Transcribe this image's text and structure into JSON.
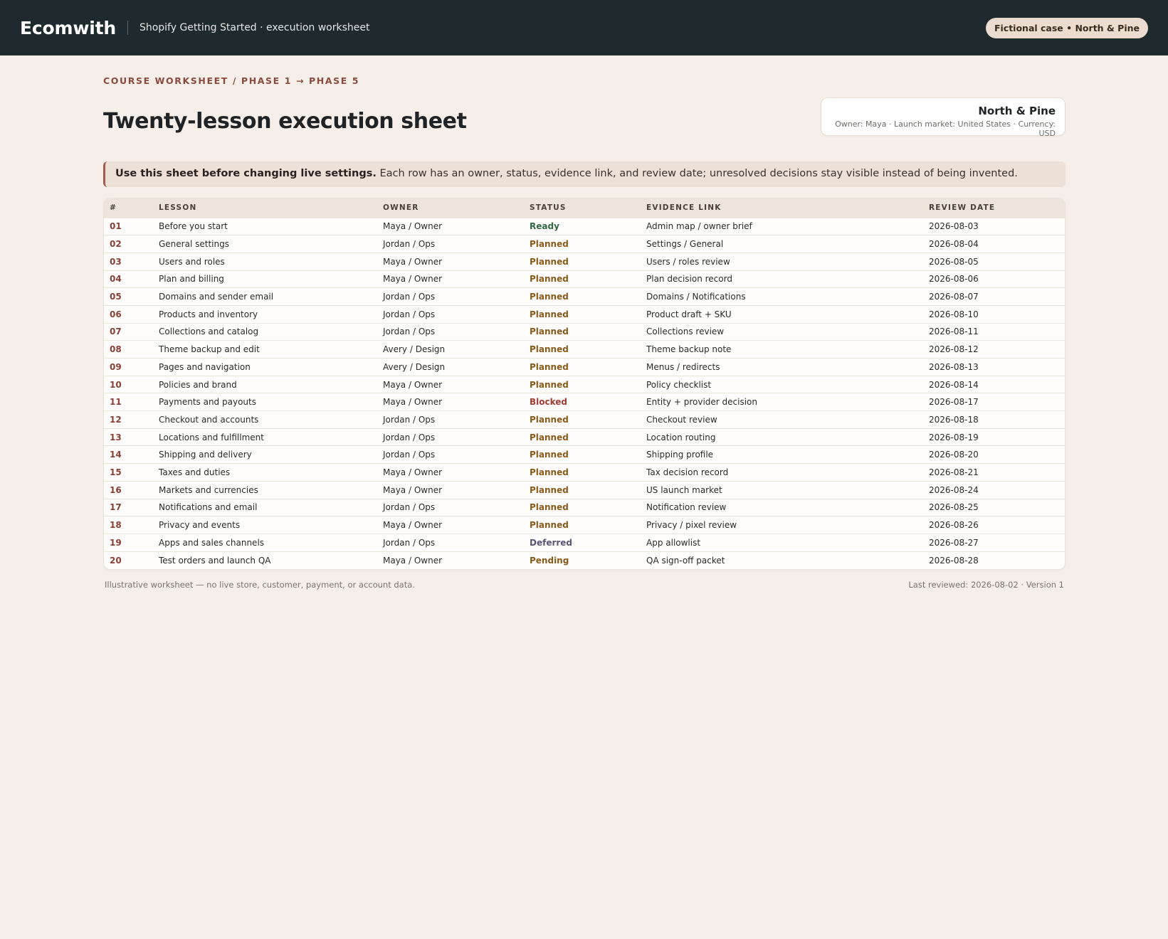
{
  "topbar": {
    "brand": "Ecomwith",
    "subtitle": "Shopify Getting Started · execution worksheet",
    "case_pill": "Fictional case • North & Pine"
  },
  "header": {
    "eyebrow": "COURSE WORKSHEET / PHASE 1 → PHASE 5",
    "title": "Twenty-lesson execution sheet",
    "case_card": {
      "name": "North & Pine",
      "meta": "Owner: Maya · Launch market: United States · Currency: USD"
    }
  },
  "notice": {
    "lead": "Use this sheet before changing live settings.",
    "body": "Each row has an owner, status, evidence link, and review date; unresolved decisions stay visible instead of being invented."
  },
  "table": {
    "columns": [
      "#",
      "LESSON",
      "OWNER",
      "STATUS",
      "EVIDENCE LINK",
      "REVIEW DATE"
    ],
    "rows": [
      {
        "num": "01",
        "lesson": "Before you start",
        "owner": "Maya / Owner",
        "status": "Ready",
        "evidence": "Admin map / owner brief",
        "date": "2026-08-03"
      },
      {
        "num": "02",
        "lesson": "General settings",
        "owner": "Jordan / Ops",
        "status": "Planned",
        "evidence": "Settings / General",
        "date": "2026-08-04"
      },
      {
        "num": "03",
        "lesson": "Users and roles",
        "owner": "Maya / Owner",
        "status": "Planned",
        "evidence": "Users / roles review",
        "date": "2026-08-05"
      },
      {
        "num": "04",
        "lesson": "Plan and billing",
        "owner": "Maya / Owner",
        "status": "Planned",
        "evidence": "Plan decision record",
        "date": "2026-08-06"
      },
      {
        "num": "05",
        "lesson": "Domains and sender email",
        "owner": "Jordan / Ops",
        "status": "Planned",
        "evidence": "Domains / Notifications",
        "date": "2026-08-07"
      },
      {
        "num": "06",
        "lesson": "Products and inventory",
        "owner": "Jordan / Ops",
        "status": "Planned",
        "evidence": "Product draft + SKU",
        "date": "2026-08-10"
      },
      {
        "num": "07",
        "lesson": "Collections and catalog",
        "owner": "Jordan / Ops",
        "status": "Planned",
        "evidence": "Collections review",
        "date": "2026-08-11"
      },
      {
        "num": "08",
        "lesson": "Theme backup and edit",
        "owner": "Avery / Design",
        "status": "Planned",
        "evidence": "Theme backup note",
        "date": "2026-08-12"
      },
      {
        "num": "09",
        "lesson": "Pages and navigation",
        "owner": "Avery / Design",
        "status": "Planned",
        "evidence": "Menus / redirects",
        "date": "2026-08-13"
      },
      {
        "num": "10",
        "lesson": "Policies and brand",
        "owner": "Maya / Owner",
        "status": "Planned",
        "evidence": "Policy checklist",
        "date": "2026-08-14"
      },
      {
        "num": "11",
        "lesson": "Payments and payouts",
        "owner": "Maya / Owner",
        "status": "Blocked",
        "evidence": "Entity + provider decision",
        "date": "2026-08-17"
      },
      {
        "num": "12",
        "lesson": "Checkout and accounts",
        "owner": "Jordan / Ops",
        "status": "Planned",
        "evidence": "Checkout review",
        "date": "2026-08-18"
      },
      {
        "num": "13",
        "lesson": "Locations and fulfillment",
        "owner": "Jordan / Ops",
        "status": "Planned",
        "evidence": "Location routing",
        "date": "2026-08-19"
      },
      {
        "num": "14",
        "lesson": "Shipping and delivery",
        "owner": "Jordan / Ops",
        "status": "Planned",
        "evidence": "Shipping profile",
        "date": "2026-08-20"
      },
      {
        "num": "15",
        "lesson": "Taxes and duties",
        "owner": "Maya / Owner",
        "status": "Planned",
        "evidence": "Tax decision record",
        "date": "2026-08-21"
      },
      {
        "num": "16",
        "lesson": "Markets and currencies",
        "owner": "Maya / Owner",
        "status": "Planned",
        "evidence": "US launch market",
        "date": "2026-08-24"
      },
      {
        "num": "17",
        "lesson": "Notifications and email",
        "owner": "Jordan / Ops",
        "status": "Planned",
        "evidence": "Notification review",
        "date": "2026-08-25"
      },
      {
        "num": "18",
        "lesson": "Privacy and events",
        "owner": "Maya / Owner",
        "status": "Planned",
        "evidence": "Privacy / pixel review",
        "date": "2026-08-26"
      },
      {
        "num": "19",
        "lesson": "Apps and sales channels",
        "owner": "Jordan / Ops",
        "status": "Deferred",
        "evidence": "App allowlist",
        "date": "2026-08-27"
      },
      {
        "num": "20",
        "lesson": "Test orders and launch QA",
        "owner": "Maya / Owner",
        "status": "Pending",
        "evidence": "QA sign-off packet",
        "date": "2026-08-28"
      }
    ]
  },
  "footer": {
    "left": "Illustrative worksheet — no live store, customer, payment, or account data.",
    "right": "Last reviewed: 2026-08-02 · Version 1"
  },
  "colors": {
    "topbar": "#1f2a2e",
    "page_bg": "#f6efe9",
    "accent": "#8a4a3e",
    "status_ready": "#2f6a42",
    "status_planned": "#8a5a1a",
    "status_blocked": "#a33a33",
    "status_deferred": "#5b5578"
  }
}
